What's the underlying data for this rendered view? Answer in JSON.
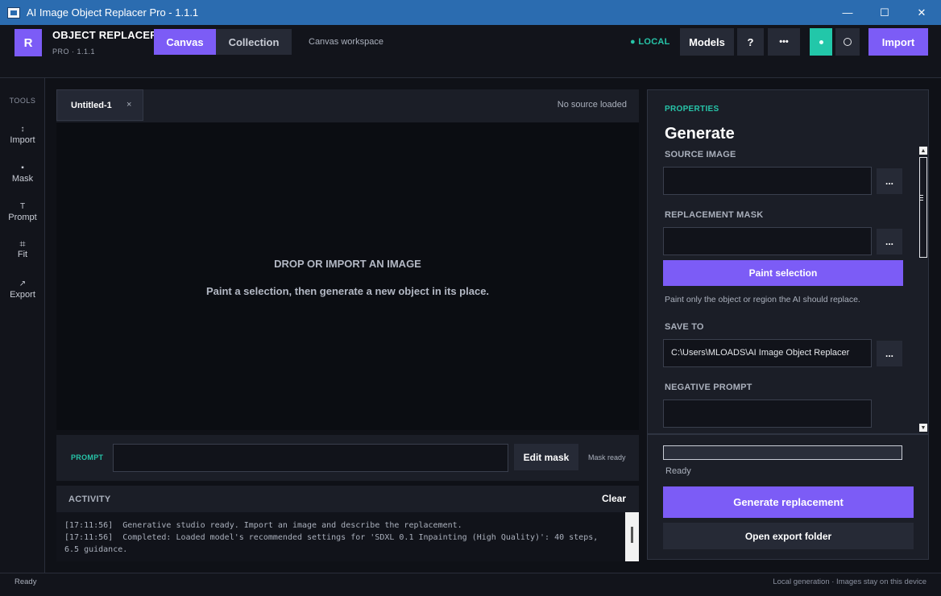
{
  "window": {
    "title": "AI Image Object Replacer Pro - 1.1.1",
    "minimize": "—",
    "maximize": "☐",
    "close": "✕"
  },
  "header": {
    "logo_letter": "R",
    "brand": "OBJECT REPLACER",
    "brand_sub": "PRO · 1.1.1",
    "tabs": [
      {
        "label": "Canvas",
        "active": true
      },
      {
        "label": "Collection",
        "active": false
      }
    ],
    "workspace_label": "Canvas workspace",
    "local_status": "LOCAL",
    "models_label": "Models",
    "help_label": "?",
    "more_label": "•••",
    "import_label": "Import"
  },
  "toolbar": {
    "label": "TOOLS",
    "tools": [
      {
        "icon": "↕",
        "label": "Import"
      },
      {
        "icon": "▪",
        "label": "Mask"
      },
      {
        "icon": "T",
        "label": "Prompt"
      },
      {
        "icon": "⌗",
        "label": "Fit"
      },
      {
        "icon": "↗",
        "label": "Export"
      }
    ]
  },
  "document": {
    "tab_name": "Untitled-1",
    "tab_close": "×",
    "source_status": "No source loaded",
    "drop_title": "DROP OR IMPORT AN IMAGE",
    "drop_subtitle": "Paint a selection, then generate a new object in its place."
  },
  "prompt": {
    "label": "PROMPT",
    "value": "",
    "edit_mask_label": "Edit mask",
    "mask_status": "Mask ready"
  },
  "activity": {
    "label": "ACTIVITY",
    "clear_label": "Clear",
    "log": [
      "[17:11:56]  Generative studio ready. Import an image and describe the replacement.",
      "[17:11:56]  Completed: Loaded model's recommended settings for 'SDXL 0.1 Inpainting (High Quality)': 40 steps, 6.5 guidance."
    ]
  },
  "properties": {
    "section_label": "PROPERTIES",
    "title": "Generate",
    "source_image_label": "SOURCE IMAGE",
    "source_image_value": "",
    "replacement_mask_label": "REPLACEMENT MASK",
    "replacement_mask_value": "",
    "browse_label": "...",
    "paint_selection_label": "Paint selection",
    "paint_hint": "Paint only the object or region the AI should replace.",
    "save_to_label": "SAVE TO",
    "save_to_value": "C:\\Users\\MLOADS\\AI Image Object Replacer",
    "negative_prompt_label": "NEGATIVE PROMPT",
    "negative_prompt_value": ""
  },
  "generate": {
    "progress": 0,
    "status": "Ready",
    "generate_label": "Generate replacement",
    "open_folder_label": "Open export folder"
  },
  "statusbar": {
    "left": "Ready",
    "right": "Local generation · Images stay on this device"
  },
  "colors": {
    "accent": "#7c5cf6",
    "teal": "#22c7a9",
    "background": "#0f1117",
    "panel": "#1b1e27",
    "titlebar": "#2b6cb0"
  }
}
